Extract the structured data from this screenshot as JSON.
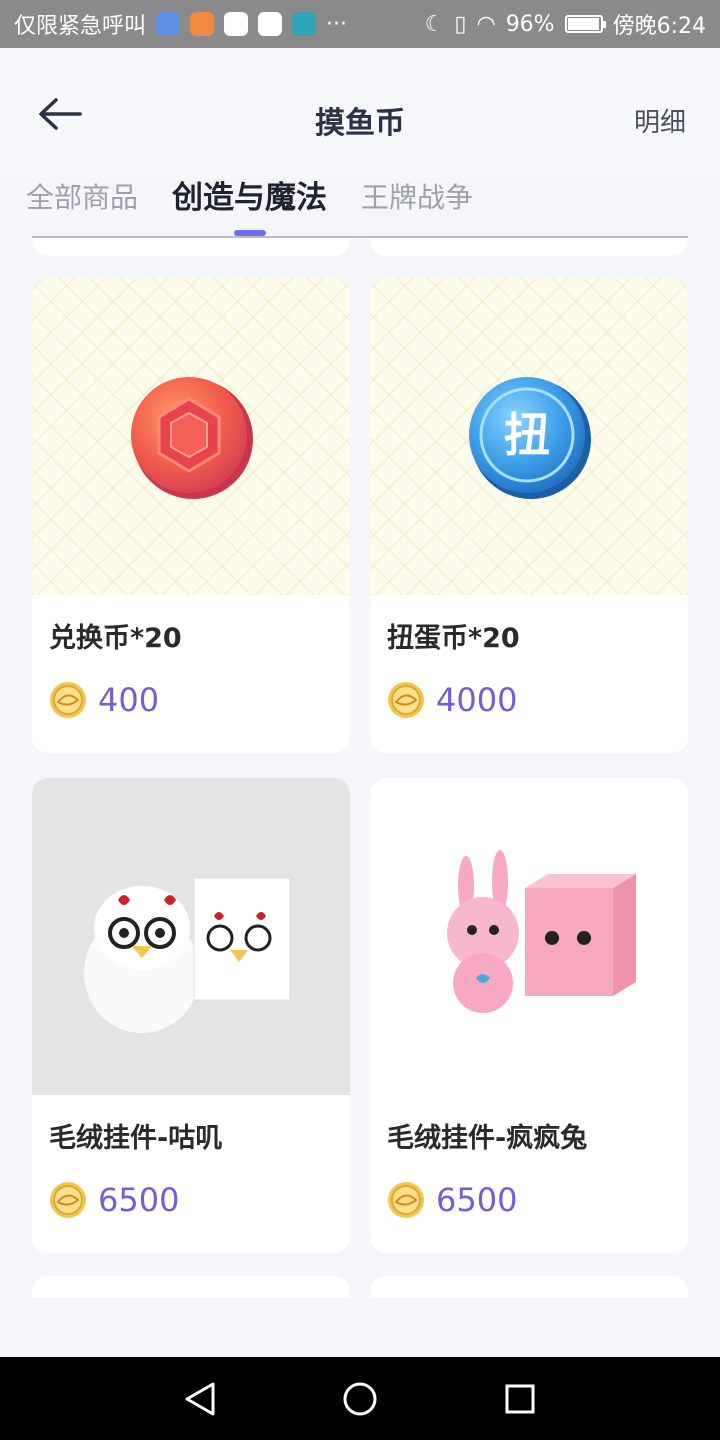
{
  "status_bar": {
    "left_text": "仅限紧急呼叫",
    "more": "···",
    "battery": "96%",
    "battery_level": 0.96,
    "time": "傍晚6:24",
    "app_icon_colors": [
      "#5b8fe0",
      "#f08a3c",
      "#ffffff",
      "#ffffff",
      "#2fa6b7"
    ]
  },
  "header": {
    "title": "摸鱼币",
    "detail_label": "明细"
  },
  "tabs": [
    {
      "label": "全部商品",
      "active": false
    },
    {
      "label": "创造与魔法",
      "active": true
    },
    {
      "label": "王牌战争",
      "active": false
    }
  ],
  "colors": {
    "accent": "#6b6ef0",
    "price": "#7a5bd6"
  },
  "products": [
    {
      "name": "兑换币*20",
      "price": "400",
      "image": "red-gem-coin-image"
    },
    {
      "name": "扭蛋币*20",
      "price": "4000",
      "image": "blue-gacha-coin-image",
      "coin_char": "扭"
    },
    {
      "name": "毛绒挂件-咕叽",
      "price": "6500",
      "image": "white-chick-plush-image"
    },
    {
      "name": "毛绒挂件-疯疯兔",
      "price": "6500",
      "image": "pink-rabbit-plush-image"
    }
  ],
  "nav": [
    "back-triangle-icon",
    "home-circle-icon",
    "recents-square-icon"
  ]
}
